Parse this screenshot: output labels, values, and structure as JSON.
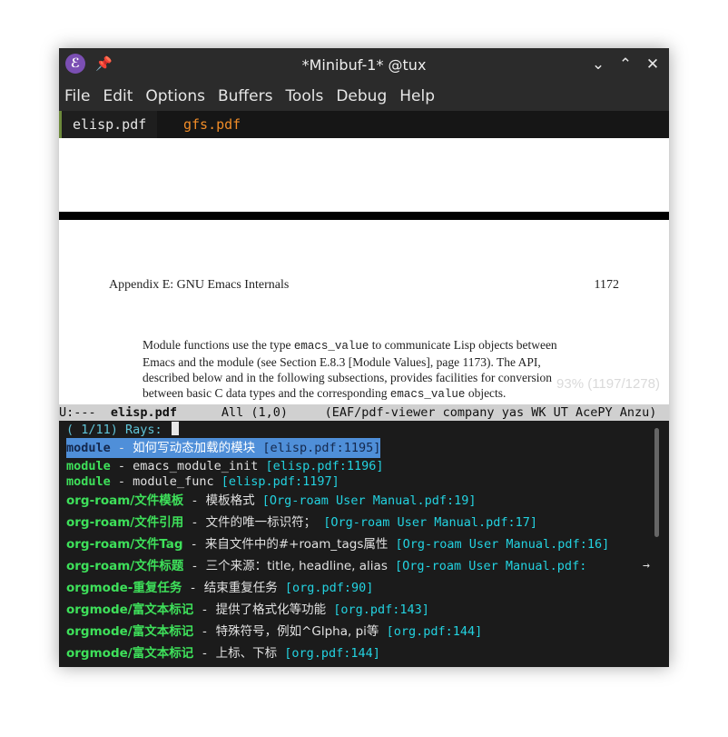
{
  "window": {
    "title": "*Minibuf-1* @tux",
    "app_icon": "emacs-icon",
    "pin_icon": "pin-icon"
  },
  "window_buttons": {
    "minimize": "⌄",
    "maximize": "⌃",
    "close": "✕"
  },
  "menu": [
    "File",
    "Edit",
    "Options",
    "Buffers",
    "Tools",
    "Debug",
    "Help"
  ],
  "tabs": [
    {
      "label": "elisp.pdf",
      "active": true
    },
    {
      "label": "gfs.pdf",
      "active": false
    }
  ],
  "pdf": {
    "header_left": "Appendix E: GNU Emacs Internals",
    "header_right": "1172",
    "body_lines": [
      [
        "Module functions use the type ",
        "emacs_value",
        " to communicate Lisp objects between"
      ],
      [
        "Emacs and the module (see Section E.8.3 [Module Values], page 1173).  The API,",
        "",
        ""
      ],
      [
        "described below and in the following subsections, provides facilities for conversion",
        "",
        ""
      ],
      [
        "between basic C data types and the corresponding ",
        "emacs_value",
        " objects."
      ]
    ],
    "page_indicator": "93% (1197/1278)"
  },
  "modeline": {
    "status": "U:---  ",
    "buffer": "elisp.pdf",
    "position": "      All (1,0)     ",
    "modes": "(EAF/pdf-viewer company yas WK UT AcePY Anzu)"
  },
  "minibuffer": {
    "prompt": "( 1/11) Rays: ",
    "candidates": [
      {
        "keyword": "module",
        "sep": " - ",
        "desc": "如何写动态加载的模块",
        "ref": "[elisp.pdf:1195]",
        "selected": true
      },
      {
        "keyword": "module",
        "sep": " - ",
        "desc": "emacs_module_init",
        "ref": "[elisp.pdf:1196]",
        "selected": false
      },
      {
        "keyword": "module",
        "sep": " - ",
        "desc": "module_func",
        "ref": "[elisp.pdf:1197]",
        "selected": false
      },
      {
        "keyword": "org-roam/文件模板",
        "sep": " - ",
        "desc": "模板格式",
        "ref": "[Org-roam User Manual.pdf:19]",
        "selected": false
      },
      {
        "keyword": "org-roam/文件引用",
        "sep": " - ",
        "desc": "文件的唯一标识符；",
        "ref": "[Org-roam User Manual.pdf:17]",
        "selected": false
      },
      {
        "keyword": "org-roam/文件Tag",
        "sep": " - ",
        "desc": "来自文件中的#+roam_tags属性",
        "ref": "[Org-roam User Manual.pdf:16]",
        "selected": false
      },
      {
        "keyword": "org-roam/文件标题",
        "sep": " - ",
        "desc": "三个来源：title, headline, alias",
        "ref": "[Org-roam User Manual.pdf:",
        "selected": false
      },
      {
        "keyword": "orgmode-重复任务",
        "sep": " - ",
        "desc": "结束重复任务",
        "ref": "[org.pdf:90]",
        "selected": false
      },
      {
        "keyword": "orgmode/富文本标记",
        "sep": " - ",
        "desc": "提供了格式化等功能",
        "ref": "[org.pdf:143]",
        "selected": false
      },
      {
        "keyword": "orgmode/富文本标记",
        "sep": " - ",
        "desc": "特殊符号，例如^Glpha, pi等",
        "ref": "[org.pdf:144]",
        "selected": false
      },
      {
        "keyword": "orgmode/富文本标记",
        "sep": " - ",
        "desc": "上标、下标",
        "ref": "[org.pdf:144]",
        "selected": false
      }
    ],
    "overflow_indicator": "→"
  }
}
